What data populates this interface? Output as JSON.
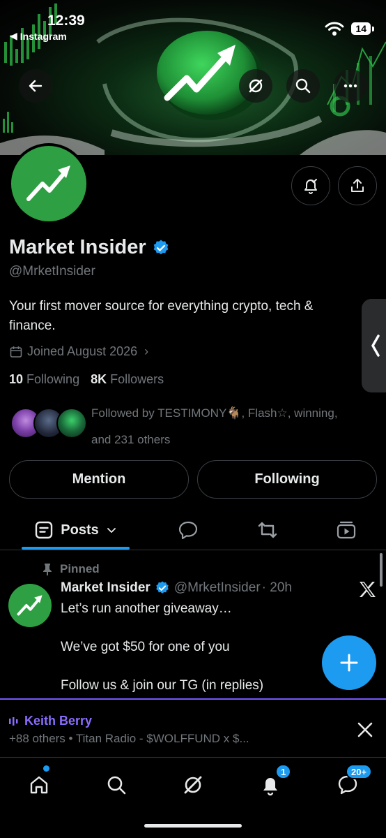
{
  "status_bar": {
    "time": "12:39",
    "back_app": "Instagram",
    "battery": "14"
  },
  "profile": {
    "display_name": "Market Insider",
    "handle": "@MrketInsider",
    "bio": "Your first mover source for everything crypto, tech & finance.",
    "joined": "Joined August 2026",
    "following_count": "10",
    "following_label": "Following",
    "followers_count": "8K",
    "followers_label": "Followers",
    "followed_by_line1": "Followed by TESTIMONY🐐, Flash☆, winning,",
    "followed_by_line2": "and 231 others"
  },
  "actions": {
    "mention": "Mention",
    "following": "Following"
  },
  "tabs": {
    "posts": "Posts"
  },
  "post": {
    "pinned_label": "Pinned",
    "author_name": "Market Insider",
    "author_handle": "@MrketInsider",
    "time": "· 20h",
    "lines": [
      "Let’s run another giveaway…",
      "We’ve got $50 for one of you",
      "Follow us & join our TG (in replies)"
    ]
  },
  "space_bar": {
    "host": "Keith Berry",
    "subtitle": "+88 others • Titan Radio - $WOLFFUND x $..."
  },
  "bottom_nav": {
    "notifications_badge": "1",
    "messages_badge": "20+"
  },
  "colors": {
    "accent": "#1d9bf0",
    "brand_green": "#2ea043",
    "space_purple": "#7856ff",
    "muted": "#71767b"
  }
}
